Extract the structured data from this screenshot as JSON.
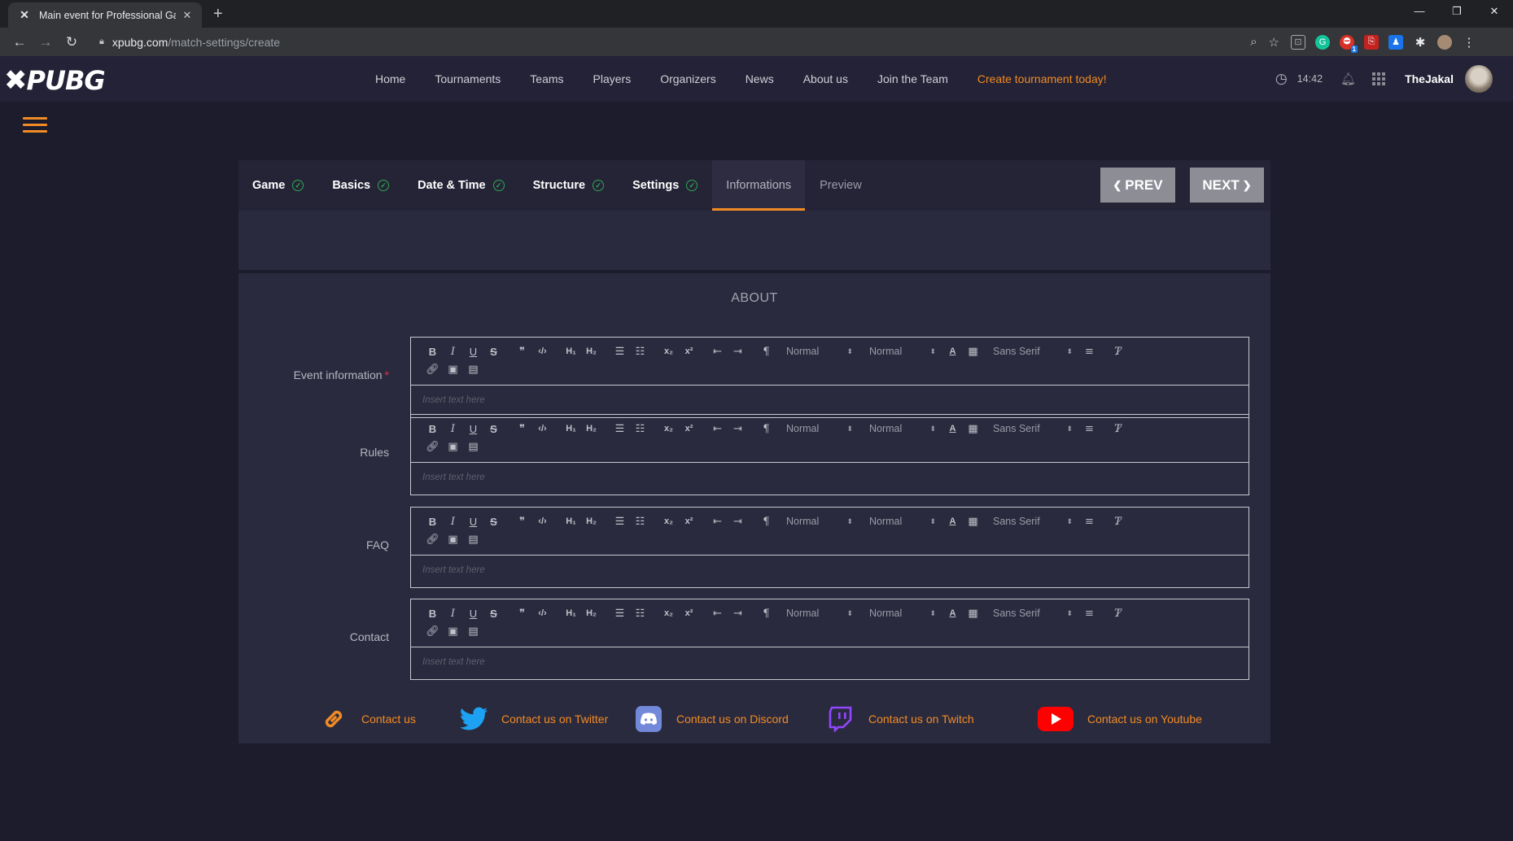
{
  "browser": {
    "tab_title": "Main event for Professional Gam",
    "url_host": "xpubg.com",
    "url_path": "/match-settings/create",
    "extension_badge": "1"
  },
  "site": {
    "logo_text": "PUBG",
    "nav": [
      {
        "label": "Home"
      },
      {
        "label": "Tournaments"
      },
      {
        "label": "Teams"
      },
      {
        "label": "Players"
      },
      {
        "label": "Organizers"
      },
      {
        "label": "News"
      },
      {
        "label": "About us"
      },
      {
        "label": "Join the Team"
      }
    ],
    "cta": "Create tournament today!",
    "time": "14:42",
    "username": "TheJakal",
    "accent_color": "#f28b24"
  },
  "wizard": {
    "steps": [
      {
        "label": "Game",
        "done": true
      },
      {
        "label": "Basics",
        "done": true
      },
      {
        "label": "Date & Time",
        "done": true
      },
      {
        "label": "Structure",
        "done": true
      },
      {
        "label": "Settings",
        "done": true
      },
      {
        "label": "Informations",
        "done": false,
        "active": true
      },
      {
        "label": "Preview",
        "done": false
      }
    ],
    "prev_label": "PREV",
    "next_label": "NEXT"
  },
  "form": {
    "section_title": "ABOUT",
    "toolbar": {
      "bold": "B",
      "italic": "I",
      "underline": "U",
      "strike": "S",
      "blockquote": "99",
      "code": "</>",
      "h1": "H1",
      "h2": "H2",
      "subscript": "x2",
      "superscript": "x2",
      "size_select": "Normal",
      "header_select": "Normal",
      "font_select": "Sans Serif"
    },
    "placeholder": "Insert text here",
    "fields": [
      {
        "label": "Event information",
        "required": true
      },
      {
        "label": "Rules",
        "required": false
      },
      {
        "label": "FAQ",
        "required": false
      },
      {
        "label": "Contact",
        "required": false
      }
    ]
  },
  "contacts": [
    {
      "label": "Contact us",
      "icon": "link-icon"
    },
    {
      "label": "Contact us on Twitter",
      "icon": "twitter-icon"
    },
    {
      "label": "Contact us on Discord",
      "icon": "discord-icon"
    },
    {
      "label": "Contact us on Twitch",
      "icon": "twitch-icon"
    },
    {
      "label": "Contact us on Youtube",
      "icon": "youtube-icon"
    }
  ]
}
